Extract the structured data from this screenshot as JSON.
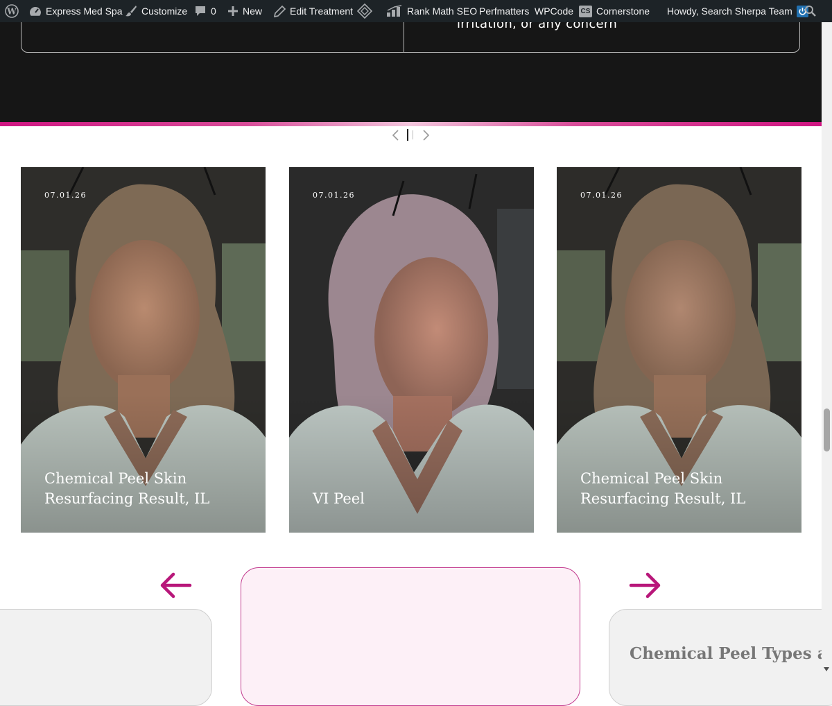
{
  "admin_bar": {
    "site_name": "Express Med Spa",
    "customize": "Customize",
    "comments_count": "0",
    "new": "New",
    "edit": "Edit Treatment",
    "rank_math": "Rank Math SEO",
    "perfmatters": "Perfmatters",
    "wpcode": "WPCode",
    "cornerstone_badge": "CS",
    "cornerstone": "Cornerstone",
    "howdy": "Howdy, Search Sherpa Team"
  },
  "dark_section": {
    "concern_text": "irritation, or any concern"
  },
  "cards": [
    {
      "date": "07.01.26",
      "title": "Chemical Peel Skin Resurfacing Result, IL"
    },
    {
      "date": "07.01.26",
      "title": "VI Peel"
    },
    {
      "date": "07.01.26",
      "title": "Chemical Peel Skin Resurfacing Result, IL"
    }
  ],
  "bottom": {
    "right_card_title": "Chemical Peel Types and"
  },
  "colors": {
    "accent": "#b8177a",
    "admin_bar": "#1d2327",
    "dark_section": "#161616"
  }
}
